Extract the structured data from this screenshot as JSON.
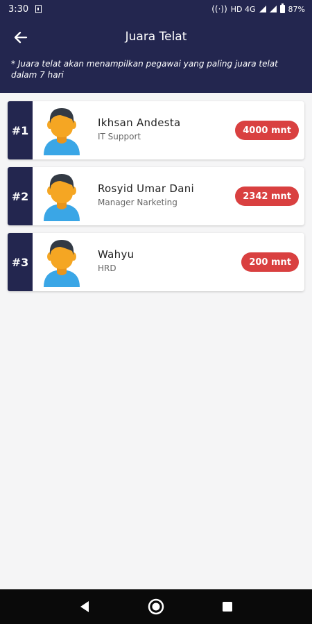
{
  "status_bar": {
    "time": "3:30",
    "network_label": "HD 4G",
    "battery": "87%"
  },
  "app_bar": {
    "title": "Juara Telat",
    "notice": "* Juara telat akan menampilkan pegawai yang paling juara telat dalam 7 hari"
  },
  "ranking": [
    {
      "rank": "#1",
      "name": "Ikhsan Andesta",
      "job": "IT Support",
      "late": "4000 mnt"
    },
    {
      "rank": "#2",
      "name": "Rosyid Umar Dani",
      "job": "Manager Narketing",
      "late": "2342 mnt"
    },
    {
      "rank": "#3",
      "name": "Wahyu",
      "job": "HRD",
      "late": "200 mnt"
    }
  ],
  "colors": {
    "primary": "#23264f",
    "badge": "#d94040",
    "background": "#f5f5f6",
    "avatar_skin": "#f5a623",
    "avatar_shirt": "#3aa6e6",
    "avatar_hair": "#333a44"
  },
  "icons": {
    "back": "arrow-left-icon",
    "avatar": "person-avatar-icon",
    "nav_back": "triangle-back-icon",
    "nav_home": "circle-home-icon",
    "nav_recents": "square-recents-icon"
  }
}
